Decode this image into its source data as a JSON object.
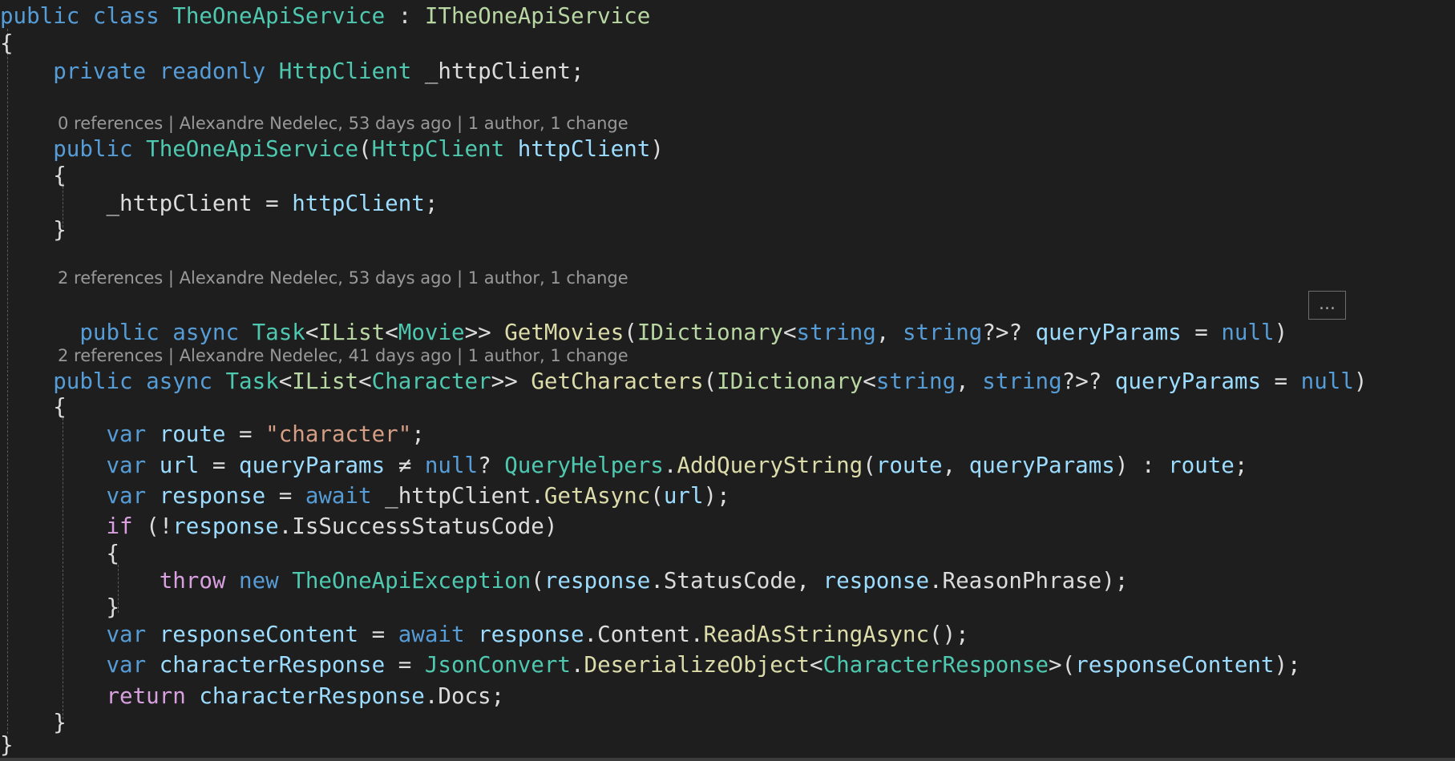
{
  "colors": {
    "background": "#1e1e1e",
    "keyword": "#569cd6",
    "control_keyword": "#d8a0df",
    "type": "#4ec9b0",
    "interface": "#b8d7a3",
    "method": "#dcdcaa",
    "variable": "#9cdcfe",
    "string": "#d69d85",
    "plain": "#dcdcdc",
    "codelens": "#999999"
  },
  "codelens": {
    "constructor": "0 references | Alexandre Nedelec, 53 days ago | 1 author, 1 change",
    "get_movies": "2 references | Alexandre Nedelec, 53 days ago | 1 author, 1 change",
    "get_characters": "2 references | Alexandre Nedelec, 41 days ago | 1 author, 1 change"
  },
  "collapsed_marker": "...",
  "code_lines": [
    {
      "id": "class-decl",
      "tokens": [
        {
          "t": "public",
          "c": "keyword"
        },
        {
          "t": " ",
          "c": "plain"
        },
        {
          "t": "class",
          "c": "keyword"
        },
        {
          "t": " ",
          "c": "plain"
        },
        {
          "t": "TheOneApiService",
          "c": "type"
        },
        {
          "t": " : ",
          "c": "plain"
        },
        {
          "t": "ITheOneApiService",
          "c": "interface"
        }
      ]
    },
    {
      "id": "class-open-brace",
      "tokens": [
        {
          "t": "{",
          "c": "plain"
        }
      ]
    },
    {
      "id": "field-decl",
      "tokens": [
        {
          "t": "    ",
          "c": "plain"
        },
        {
          "t": "private",
          "c": "keyword"
        },
        {
          "t": " ",
          "c": "plain"
        },
        {
          "t": "readonly",
          "c": "keyword"
        },
        {
          "t": " ",
          "c": "plain"
        },
        {
          "t": "HttpClient",
          "c": "type"
        },
        {
          "t": " _httpClient;",
          "c": "plain"
        }
      ]
    },
    {
      "id": "ctor-decl",
      "tokens": [
        {
          "t": "    ",
          "c": "plain"
        },
        {
          "t": "public",
          "c": "keyword"
        },
        {
          "t": " ",
          "c": "plain"
        },
        {
          "t": "TheOneApiService",
          "c": "type"
        },
        {
          "t": "(",
          "c": "plain"
        },
        {
          "t": "HttpClient",
          "c": "type"
        },
        {
          "t": " ",
          "c": "plain"
        },
        {
          "t": "httpClient",
          "c": "variable"
        },
        {
          "t": ")",
          "c": "plain"
        }
      ]
    },
    {
      "id": "ctor-open-brace",
      "tokens": [
        {
          "t": "    {",
          "c": "plain"
        }
      ]
    },
    {
      "id": "ctor-body",
      "tokens": [
        {
          "t": "        _httpClient = ",
          "c": "plain"
        },
        {
          "t": "httpClient",
          "c": "variable"
        },
        {
          "t": ";",
          "c": "plain"
        }
      ]
    },
    {
      "id": "ctor-close-brace",
      "tokens": [
        {
          "t": "    }",
          "c": "plain"
        }
      ]
    },
    {
      "id": "getmovies-decl",
      "tokens": [
        {
          "t": "    ",
          "c": "plain"
        },
        {
          "t": "public",
          "c": "keyword"
        },
        {
          "t": " ",
          "c": "plain"
        },
        {
          "t": "async",
          "c": "keyword"
        },
        {
          "t": " ",
          "c": "plain"
        },
        {
          "t": "Task",
          "c": "type"
        },
        {
          "t": "<",
          "c": "plain"
        },
        {
          "t": "IList",
          "c": "interface"
        },
        {
          "t": "<",
          "c": "plain"
        },
        {
          "t": "Movie",
          "c": "type"
        },
        {
          "t": ">> ",
          "c": "plain"
        },
        {
          "t": "GetMovies",
          "c": "method"
        },
        {
          "t": "(",
          "c": "plain"
        },
        {
          "t": "IDictionary",
          "c": "interface"
        },
        {
          "t": "<",
          "c": "plain"
        },
        {
          "t": "string",
          "c": "keyword"
        },
        {
          "t": ", ",
          "c": "plain"
        },
        {
          "t": "string",
          "c": "keyword"
        },
        {
          "t": "?>? ",
          "c": "plain"
        },
        {
          "t": "queryParams",
          "c": "variable"
        },
        {
          "t": " = ",
          "c": "plain"
        },
        {
          "t": "null",
          "c": "keyword"
        },
        {
          "t": ")",
          "c": "plain"
        }
      ]
    },
    {
      "id": "getcharacters-decl",
      "tokens": [
        {
          "t": "    ",
          "c": "plain"
        },
        {
          "t": "public",
          "c": "keyword"
        },
        {
          "t": " ",
          "c": "plain"
        },
        {
          "t": "async",
          "c": "keyword"
        },
        {
          "t": " ",
          "c": "plain"
        },
        {
          "t": "Task",
          "c": "type"
        },
        {
          "t": "<",
          "c": "plain"
        },
        {
          "t": "IList",
          "c": "interface"
        },
        {
          "t": "<",
          "c": "plain"
        },
        {
          "t": "Character",
          "c": "type"
        },
        {
          "t": ">> ",
          "c": "plain"
        },
        {
          "t": "GetCharacters",
          "c": "method"
        },
        {
          "t": "(",
          "c": "plain"
        },
        {
          "t": "IDictionary",
          "c": "interface"
        },
        {
          "t": "<",
          "c": "plain"
        },
        {
          "t": "string",
          "c": "keyword"
        },
        {
          "t": ", ",
          "c": "plain"
        },
        {
          "t": "string",
          "c": "keyword"
        },
        {
          "t": "?>? ",
          "c": "plain"
        },
        {
          "t": "queryParams",
          "c": "variable"
        },
        {
          "t": " = ",
          "c": "plain"
        },
        {
          "t": "null",
          "c": "keyword"
        },
        {
          "t": ")",
          "c": "plain"
        }
      ]
    },
    {
      "id": "getcharacters-open-brace",
      "tokens": [
        {
          "t": "    {",
          "c": "plain"
        }
      ]
    },
    {
      "id": "route-decl",
      "tokens": [
        {
          "t": "        ",
          "c": "plain"
        },
        {
          "t": "var",
          "c": "keyword"
        },
        {
          "t": " ",
          "c": "plain"
        },
        {
          "t": "route",
          "c": "variable"
        },
        {
          "t": " = ",
          "c": "plain"
        },
        {
          "t": "\"character\"",
          "c": "string"
        },
        {
          "t": ";",
          "c": "plain"
        }
      ]
    },
    {
      "id": "url-decl",
      "tokens": [
        {
          "t": "        ",
          "c": "plain"
        },
        {
          "t": "var",
          "c": "keyword"
        },
        {
          "t": " ",
          "c": "plain"
        },
        {
          "t": "url",
          "c": "variable"
        },
        {
          "t": " = ",
          "c": "plain"
        },
        {
          "t": "queryParams",
          "c": "variable"
        },
        {
          "t": " ≠ ",
          "c": "plain"
        },
        {
          "t": "null",
          "c": "keyword"
        },
        {
          "t": "? ",
          "c": "plain"
        },
        {
          "t": "QueryHelpers",
          "c": "type"
        },
        {
          "t": ".",
          "c": "plain"
        },
        {
          "t": "AddQueryString",
          "c": "method"
        },
        {
          "t": "(",
          "c": "plain"
        },
        {
          "t": "route",
          "c": "variable"
        },
        {
          "t": ", ",
          "c": "plain"
        },
        {
          "t": "queryParams",
          "c": "variable"
        },
        {
          "t": ") : ",
          "c": "plain"
        },
        {
          "t": "route",
          "c": "variable"
        },
        {
          "t": ";",
          "c": "plain"
        }
      ]
    },
    {
      "id": "response-decl",
      "tokens": [
        {
          "t": "        ",
          "c": "plain"
        },
        {
          "t": "var",
          "c": "keyword"
        },
        {
          "t": " ",
          "c": "plain"
        },
        {
          "t": "response",
          "c": "variable"
        },
        {
          "t": " = ",
          "c": "plain"
        },
        {
          "t": "await",
          "c": "keyword"
        },
        {
          "t": " _httpClient.",
          "c": "plain"
        },
        {
          "t": "GetAsync",
          "c": "method"
        },
        {
          "t": "(",
          "c": "plain"
        },
        {
          "t": "url",
          "c": "variable"
        },
        {
          "t": ");",
          "c": "plain"
        }
      ]
    },
    {
      "id": "if-stmt",
      "tokens": [
        {
          "t": "        ",
          "c": "plain"
        },
        {
          "t": "if",
          "c": "control_keyword"
        },
        {
          "t": " (!",
          "c": "plain"
        },
        {
          "t": "response",
          "c": "variable"
        },
        {
          "t": ".IsSuccessStatusCode)",
          "c": "plain"
        }
      ]
    },
    {
      "id": "if-open-brace",
      "tokens": [
        {
          "t": "        {",
          "c": "plain"
        }
      ]
    },
    {
      "id": "throw-stmt",
      "tokens": [
        {
          "t": "            ",
          "c": "plain"
        },
        {
          "t": "throw",
          "c": "control_keyword"
        },
        {
          "t": " ",
          "c": "plain"
        },
        {
          "t": "new",
          "c": "keyword"
        },
        {
          "t": " ",
          "c": "plain"
        },
        {
          "t": "TheOneApiException",
          "c": "type"
        },
        {
          "t": "(",
          "c": "plain"
        },
        {
          "t": "response",
          "c": "variable"
        },
        {
          "t": ".StatusCode, ",
          "c": "plain"
        },
        {
          "t": "response",
          "c": "variable"
        },
        {
          "t": ".ReasonPhrase);",
          "c": "plain"
        }
      ]
    },
    {
      "id": "if-close-brace",
      "tokens": [
        {
          "t": "        }",
          "c": "plain"
        }
      ]
    },
    {
      "id": "content-decl",
      "tokens": [
        {
          "t": "        ",
          "c": "plain"
        },
        {
          "t": "var",
          "c": "keyword"
        },
        {
          "t": " ",
          "c": "plain"
        },
        {
          "t": "responseContent",
          "c": "variable"
        },
        {
          "t": " = ",
          "c": "plain"
        },
        {
          "t": "await",
          "c": "keyword"
        },
        {
          "t": " ",
          "c": "plain"
        },
        {
          "t": "response",
          "c": "variable"
        },
        {
          "t": ".Content.",
          "c": "plain"
        },
        {
          "t": "ReadAsStringAsync",
          "c": "method"
        },
        {
          "t": "();",
          "c": "plain"
        }
      ]
    },
    {
      "id": "charresponse-decl",
      "tokens": [
        {
          "t": "        ",
          "c": "plain"
        },
        {
          "t": "var",
          "c": "keyword"
        },
        {
          "t": " ",
          "c": "plain"
        },
        {
          "t": "characterResponse",
          "c": "variable"
        },
        {
          "t": " = ",
          "c": "plain"
        },
        {
          "t": "JsonConvert",
          "c": "type"
        },
        {
          "t": ".",
          "c": "plain"
        },
        {
          "t": "DeserializeObject",
          "c": "method"
        },
        {
          "t": "<",
          "c": "plain"
        },
        {
          "t": "CharacterResponse",
          "c": "type"
        },
        {
          "t": ">(",
          "c": "plain"
        },
        {
          "t": "responseContent",
          "c": "variable"
        },
        {
          "t": ");",
          "c": "plain"
        }
      ]
    },
    {
      "id": "return-stmt",
      "tokens": [
        {
          "t": "        ",
          "c": "plain"
        },
        {
          "t": "return",
          "c": "control_keyword"
        },
        {
          "t": " ",
          "c": "plain"
        },
        {
          "t": "characterResponse",
          "c": "variable"
        },
        {
          "t": ".Docs;",
          "c": "plain"
        }
      ]
    },
    {
      "id": "getcharacters-close-brace",
      "tokens": [
        {
          "t": "    }",
          "c": "plain"
        }
      ]
    },
    {
      "id": "class-close-brace",
      "tokens": [
        {
          "t": "}",
          "c": "plain"
        }
      ]
    }
  ]
}
